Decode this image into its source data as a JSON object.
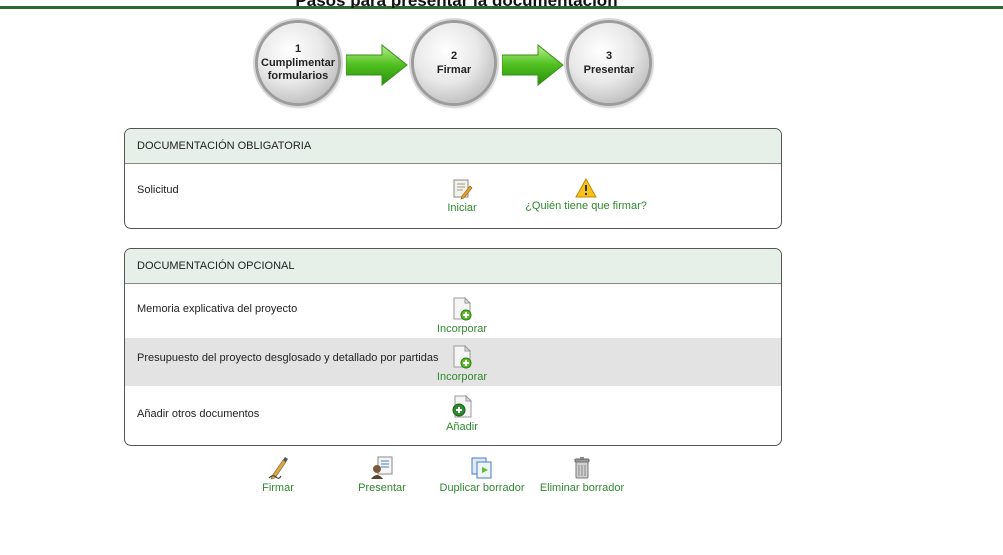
{
  "header": {
    "title": "Pasos para presentar la documentación"
  },
  "steps": [
    {
      "number": "1",
      "label_line1": "Cumplimentar",
      "label_line2": "formularios"
    },
    {
      "number": "2",
      "label_line1": "Firmar",
      "label_line2": ""
    },
    {
      "number": "3",
      "label_line1": "Presentar",
      "label_line2": ""
    }
  ],
  "mandatory": {
    "title": "DOCUMENTACIÓN OBLIGATORIA",
    "rows": [
      {
        "label": "Solicitud",
        "start_label": "Iniciar",
        "who_label": "¿Quién tiene que firmar?"
      }
    ]
  },
  "optional": {
    "title": "DOCUMENTACIÓN OPCIONAL",
    "rows": [
      {
        "label": "Memoria explicativa del proyecto",
        "action_label": "Incorporar"
      },
      {
        "label": "Presupuesto del proyecto desglosado y detallado por partidas",
        "action_label": "Incorporar"
      },
      {
        "label": "Añadir otros documentos",
        "action_label": "Añadir"
      }
    ]
  },
  "toolbar": {
    "sign_label": "Firmar",
    "submit_label": "Presentar",
    "duplicate_label": "Duplicar borrador",
    "delete_label": "Eliminar borrador"
  },
  "colors": {
    "accent_green": "#2e8a2e",
    "header_bar": "#2d6a2d",
    "panel_header_bg": "#e6f0e9"
  }
}
